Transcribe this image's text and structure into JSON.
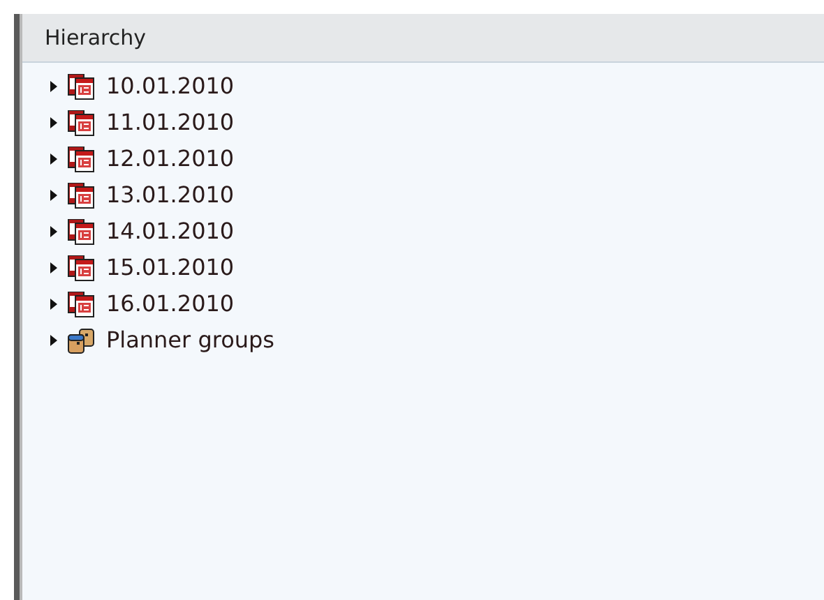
{
  "panel": {
    "title": "Hierarchy"
  },
  "tree": [
    {
      "label": "10.01.2010",
      "kind": "calendar",
      "expanded": false
    },
    {
      "label": "11.01.2010",
      "kind": "calendar",
      "expanded": false
    },
    {
      "label": "12.01.2010",
      "kind": "calendar",
      "expanded": false
    },
    {
      "label": "13.01.2010",
      "kind": "calendar",
      "expanded": false
    },
    {
      "label": "14.01.2010",
      "kind": "calendar",
      "expanded": false
    },
    {
      "label": "15.01.2010",
      "kind": "calendar",
      "expanded": false
    },
    {
      "label": "16.01.2010",
      "kind": "calendar",
      "expanded": false
    },
    {
      "label": "Planner groups",
      "kind": "group",
      "expanded": false
    }
  ]
}
